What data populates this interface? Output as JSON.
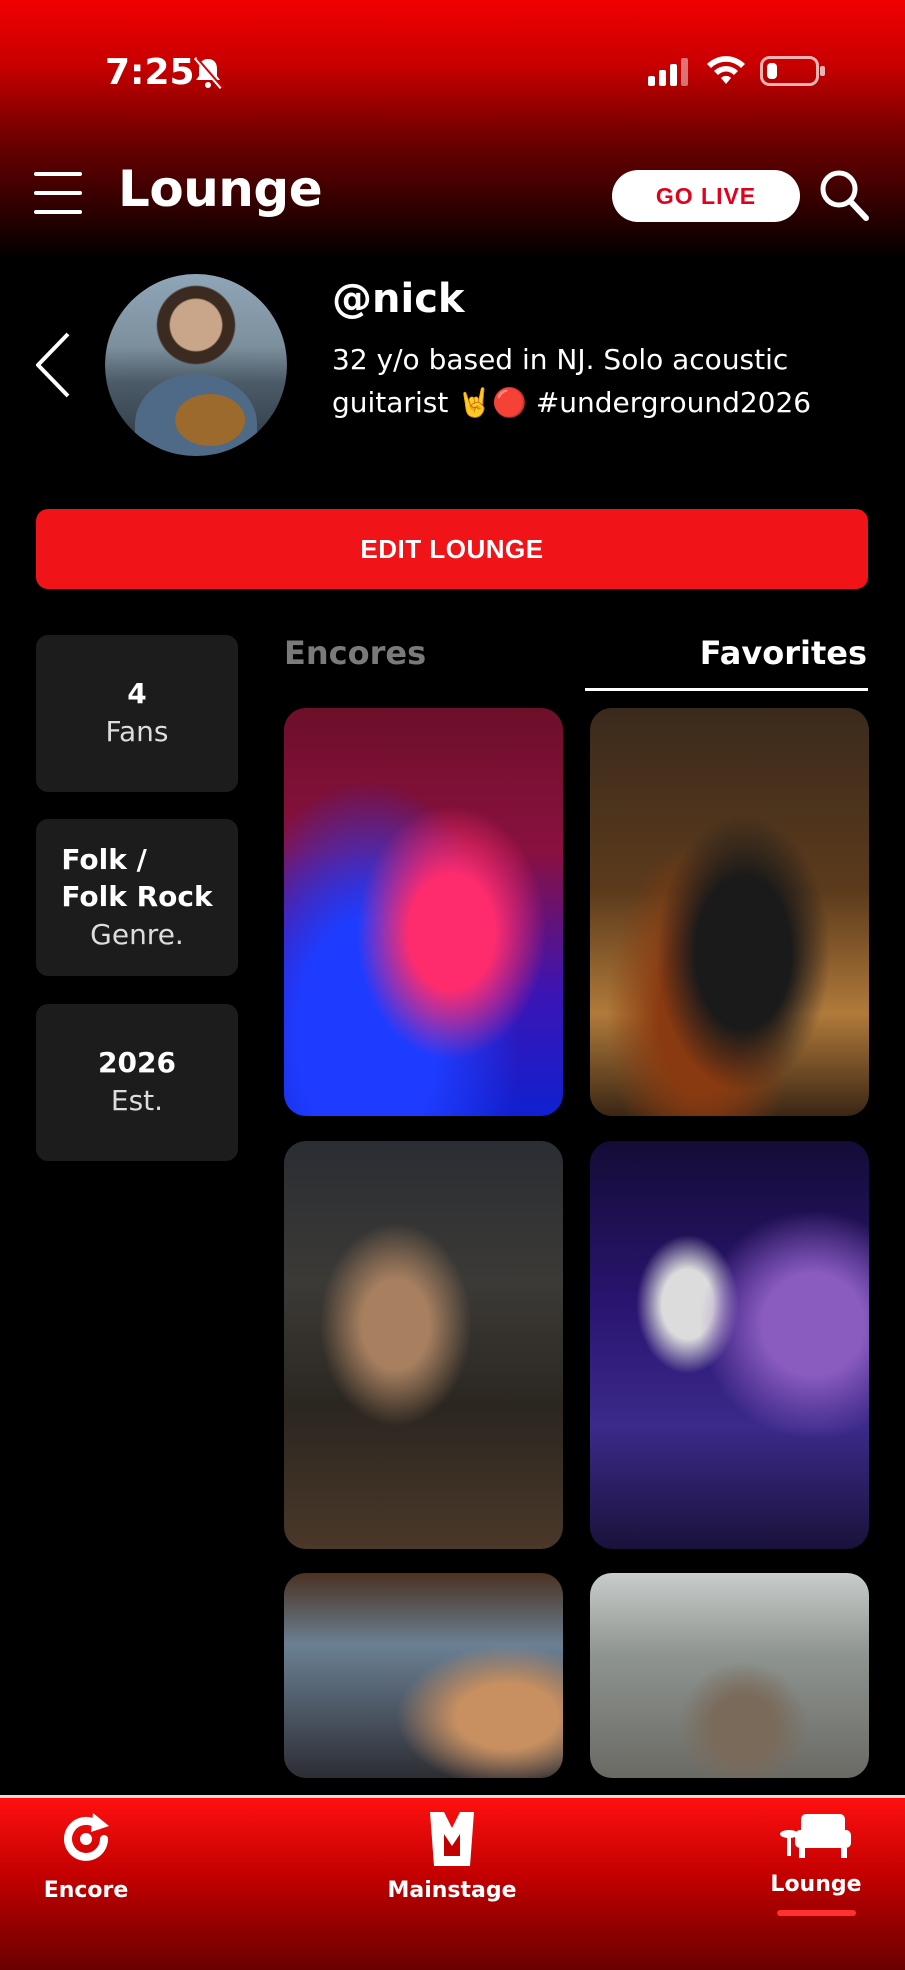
{
  "status_bar": {
    "time": "7:25"
  },
  "header": {
    "title": "Lounge",
    "go_live_label": "GO LIVE"
  },
  "profile": {
    "handle": "@nick",
    "bio_line1": "32 y/o based in NJ. Solo acoustic",
    "bio_line2": "guitarist 🤘🔴 #underground2026"
  },
  "edit_button_label": "EDIT LOUNGE",
  "stats": [
    {
      "value": "4",
      "label": "Fans"
    },
    {
      "value_line1": "Folk /",
      "value_line2": "Folk Rock",
      "label": "Genre."
    },
    {
      "value": "2026",
      "label": "Est."
    }
  ],
  "tabs": [
    {
      "label": "Encores",
      "active": false
    },
    {
      "label": "Favorites",
      "active": true
    }
  ],
  "bottom_nav": [
    {
      "label": "Encore",
      "icon": "encore-refresh-icon"
    },
    {
      "label": "Mainstage",
      "icon": "mainstage-m-icon"
    },
    {
      "label": "Lounge",
      "icon": "sofa-icon",
      "active": true
    }
  ],
  "colors": {
    "brand_red": "#f01419",
    "background": "#000000",
    "tile_bg": "#1c1c1c"
  }
}
